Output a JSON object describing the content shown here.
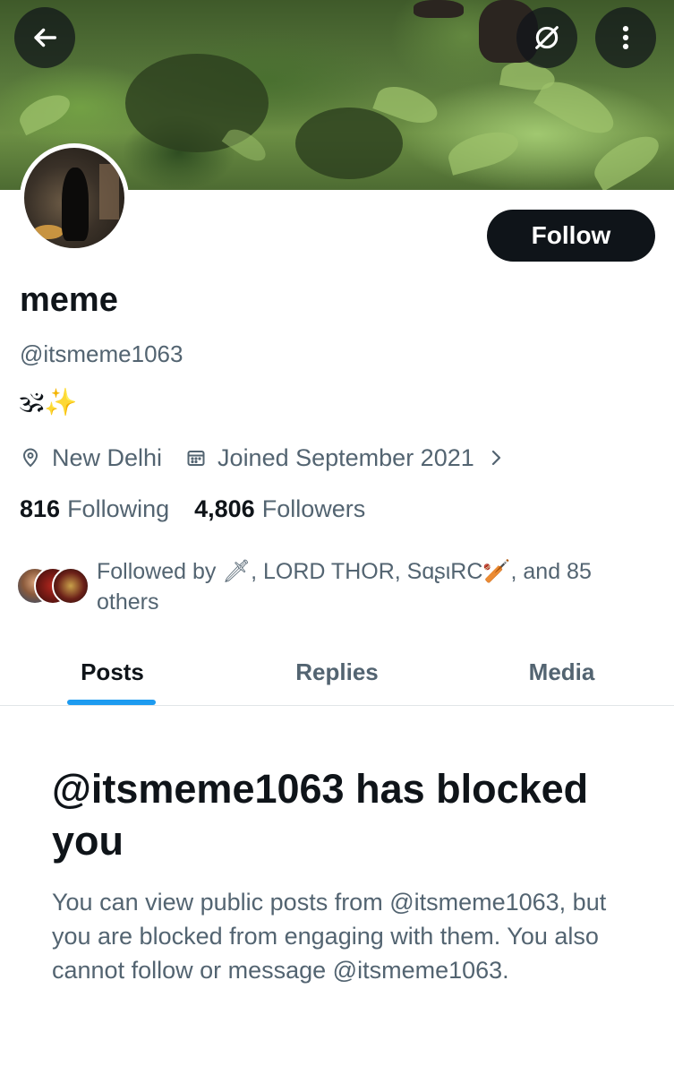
{
  "header": {
    "back_icon": "arrow-left-icon",
    "link_off_icon": "unlink-icon",
    "more_icon": "vertical-ellipsis-icon"
  },
  "profile": {
    "display_name": "meme",
    "handle": "@itsmeme1063",
    "bio": "🕉✨",
    "location": "New Delhi",
    "joined": "Joined September 2021",
    "follow_label": "Follow",
    "following_count": "816",
    "following_label": "Following",
    "followers_count": "4,806",
    "followers_label": "Followers",
    "followed_by": "Followed by 🗡, LORD THOR, SɑʂιRC🏏, and 85 others"
  },
  "tabs": [
    {
      "label": "Posts",
      "active": true
    },
    {
      "label": "Replies",
      "active": false
    },
    {
      "label": "Media",
      "active": false
    }
  ],
  "blocked": {
    "title": "@itsmeme1063 has blocked you",
    "body": "You can view public posts from @itsmeme1063, but you are blocked from engaging with them. You also cannot follow or message @itsmeme1063."
  },
  "colors": {
    "accent": "#1d9bf0",
    "text_primary": "#0f1419",
    "text_secondary": "#536471",
    "button_bg": "#0f1419"
  }
}
